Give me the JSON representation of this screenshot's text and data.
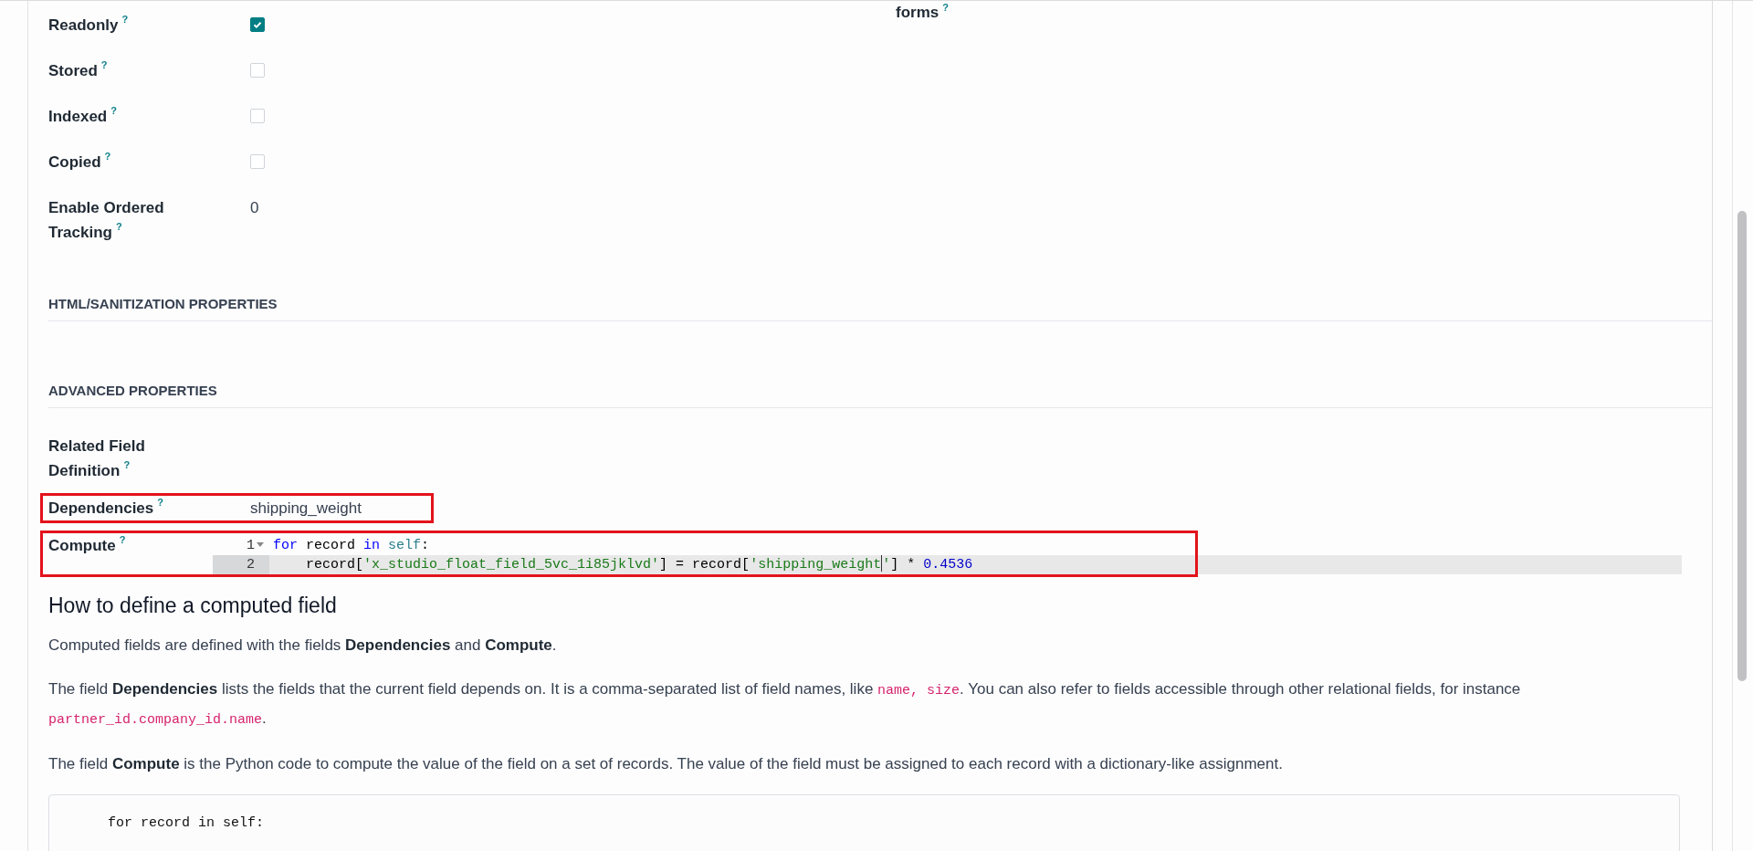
{
  "side_label": {
    "text": "forms",
    "help": "?"
  },
  "fields": [
    {
      "label": "Readonly",
      "help": "?",
      "kind": "checkbox",
      "checked": true
    },
    {
      "label": "Stored",
      "help": "?",
      "kind": "checkbox",
      "checked": false
    },
    {
      "label": "Indexed",
      "help": "?",
      "kind": "checkbox",
      "checked": false
    },
    {
      "label": "Copied",
      "help": "?",
      "kind": "checkbox",
      "checked": false
    },
    {
      "label": "Enable Ordered Tracking",
      "help": "?",
      "kind": "value",
      "value": "0"
    }
  ],
  "sections": [
    {
      "title": "HTML/SANITIZATION PROPERTIES"
    },
    {
      "title": "ADVANCED PROPERTIES",
      "fields": [
        {
          "label": "Related Field Definition",
          "help": "?",
          "kind": "empty",
          "highlighted": false
        },
        {
          "label": "Dependencies",
          "help": "?",
          "kind": "value",
          "value": "shipping_weight",
          "highlighted": true
        },
        {
          "label": "Compute",
          "help": "?",
          "kind": "code",
          "highlighted": true,
          "lines": [
            {
              "number": "1",
              "foldable": true,
              "active": false,
              "tokens": [
                {
                  "kind": "keyword",
                  "text": "for"
                },
                {
                  "kind": "plain",
                  "text": " record "
                },
                {
                  "kind": "keyword",
                  "text": "in"
                },
                {
                  "kind": "builtin",
                  "text": " self"
                },
                {
                  "kind": "plain",
                  "text": ":"
                }
              ]
            },
            {
              "number": "2",
              "foldable": false,
              "active": true,
              "tokens": [
                {
                  "kind": "plain",
                  "text": "    record["
                },
                {
                  "kind": "string",
                  "text": "'x_studio_float_field_5vc_1i85jklvd'"
                },
                {
                  "kind": "plain",
                  "text": "] = record["
                },
                {
                  "kind": "string",
                  "text": "'shipping_weight",
                  "cursor": true
                },
                {
                  "kind": "string",
                  "text": "'"
                },
                {
                  "kind": "plain",
                  "text": "] * "
                },
                {
                  "kind": "number",
                  "text": "0.4536"
                }
              ]
            }
          ]
        }
      ]
    }
  ],
  "help": {
    "title": "How to define a computed field",
    "paragraphs": [
      [
        {
          "kind": "text",
          "text": "Computed fields are defined with the fields **Dependencies** and **Compute**."
        }
      ],
      [
        {
          "kind": "text",
          "text": "The field **Dependencies** lists the fields that the current field depends on. It is a comma-separated list of field names, like "
        },
        {
          "kind": "code",
          "text": "name, size"
        },
        {
          "kind": "text",
          "text": ". You can also refer to fields accessible through other relational fields, for instance "
        },
        {
          "kind": "code",
          "text": "partner_id.company_id.name"
        },
        {
          "kind": "text",
          "text": "."
        }
      ],
      [
        {
          "kind": "text",
          "text": "The field **Compute** is the Python code to compute the value of the field on a set of records. The value of the field must be assigned to each record with a dictionary-like assignment."
        }
      ]
    ],
    "example_lines": [
      "for record in self:"
    ]
  }
}
